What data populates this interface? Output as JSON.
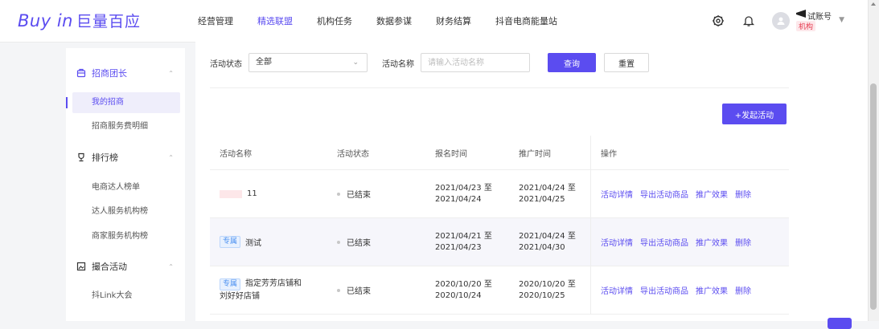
{
  "app": {
    "logo_en": "Buy in",
    "logo_cn": "巨量百应"
  },
  "nav": {
    "items": [
      {
        "label": "经营管理"
      },
      {
        "label": "精选联盟",
        "active": true
      },
      {
        "label": "机构任务"
      },
      {
        "label": "数据参谋"
      },
      {
        "label": "财务结算"
      },
      {
        "label": "抖音电商能量站"
      }
    ]
  },
  "user": {
    "name": "试账号",
    "org": "机构",
    "avatar_icon": "user-icon"
  },
  "icons": {
    "settings": "gear-icon",
    "notifications": "bell-icon"
  },
  "sidebar": {
    "groups": [
      {
        "label": "招商团长",
        "icon": "lock-icon",
        "active": true,
        "items": [
          {
            "label": "我的招商",
            "active": true
          },
          {
            "label": "招商服务费明细"
          }
        ]
      },
      {
        "label": "排行榜",
        "icon": "trophy-icon",
        "items": [
          {
            "label": "电商达人榜单"
          },
          {
            "label": "达人服务机构榜"
          },
          {
            "label": "商家服务机构榜"
          }
        ]
      },
      {
        "label": "撮合活动",
        "icon": "image-icon",
        "items": [
          {
            "label": "抖Link大会"
          }
        ]
      }
    ]
  },
  "filters": {
    "status_label": "活动状态",
    "status_value": "全部",
    "name_label": "活动名称",
    "name_placeholder": "请输入活动名称",
    "query_button": "查询",
    "reset_button": "重置"
  },
  "actions": {
    "launch_button": "+发起活动"
  },
  "table": {
    "headers": [
      "活动名称",
      "活动状态",
      "报名时间",
      "推广时间",
      "操作"
    ],
    "rows": [
      {
        "tag": "",
        "name": "11",
        "status": "已结束",
        "signup_start": "2021/04/23 至",
        "signup_end": "2021/04/24",
        "promo_start": "2021/04/24 至",
        "promo_end": "2021/04/25"
      },
      {
        "tag": "专属",
        "name": "测试",
        "status": "已结束",
        "signup_start": "2021/04/21 至",
        "signup_end": "2021/04/23",
        "promo_start": "2021/04/24 至",
        "promo_end": "2021/04/30"
      },
      {
        "tag": "专属",
        "name": "指定芳芳店铺和",
        "name_line2": "刘好好店铺",
        "status": "已结束",
        "signup_start": "2020/10/20 至",
        "signup_end": "2020/10/24",
        "promo_start": "2020/10/20 至",
        "promo_end": "2020/10/25"
      }
    ],
    "ops": [
      "活动详情",
      "导出活动商品",
      "推广效果",
      "删除"
    ]
  },
  "colors": {
    "brand": "#5b4cf0",
    "tag_blue": "#4a8ff0",
    "org_red": "#e5394e"
  }
}
